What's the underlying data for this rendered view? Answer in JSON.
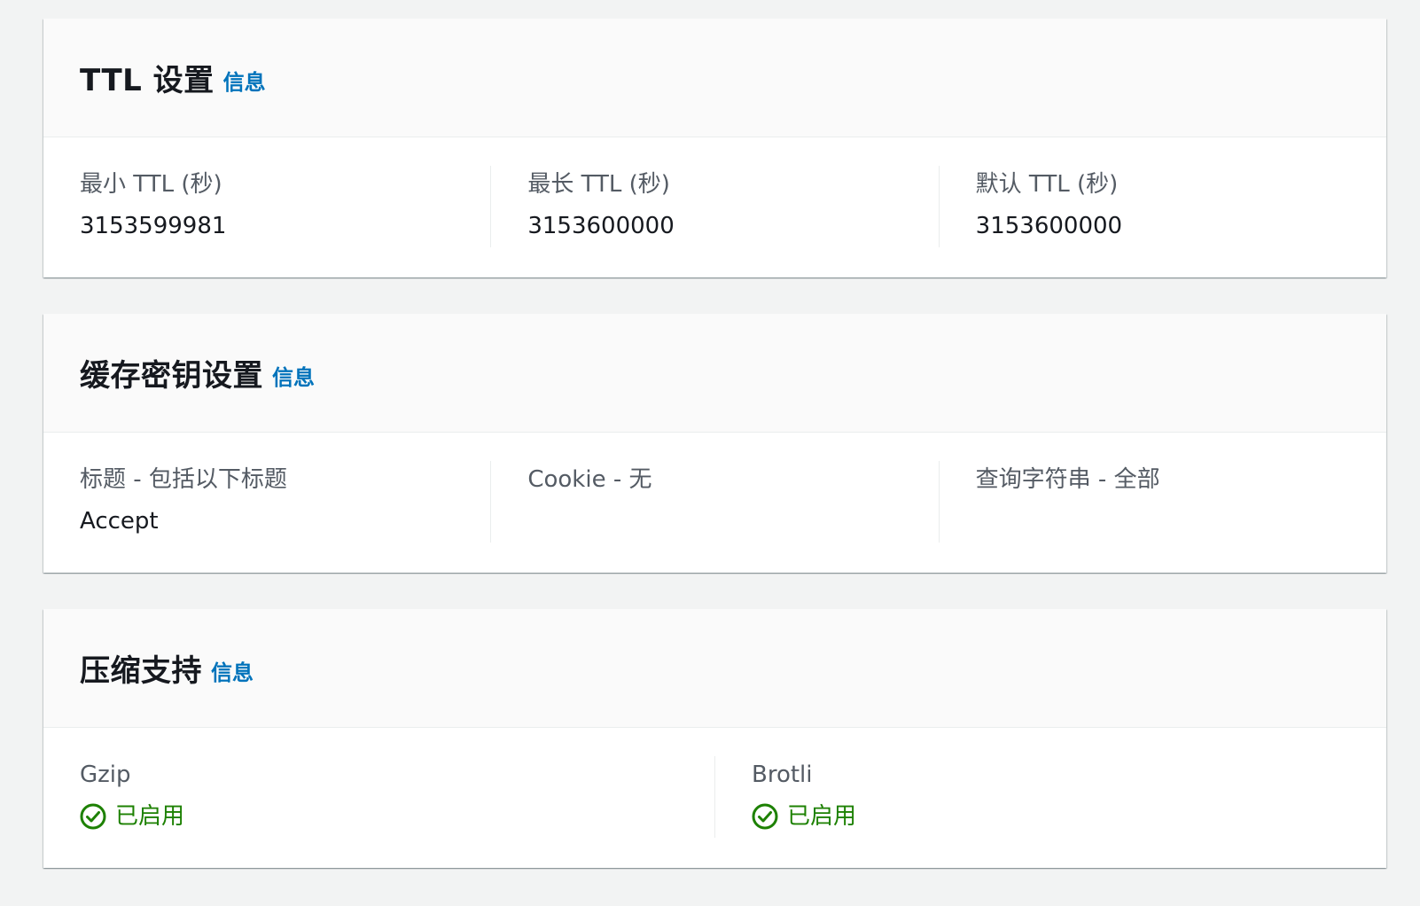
{
  "ttl": {
    "title": "TTL 设置",
    "info": "信息",
    "fields": [
      {
        "label": "最小 TTL (秒)",
        "value": "3153599981"
      },
      {
        "label": "最长 TTL (秒)",
        "value": "3153600000"
      },
      {
        "label": "默认 TTL (秒)",
        "value": "3153600000"
      }
    ]
  },
  "cache_key": {
    "title": "缓存密钥设置",
    "info": "信息",
    "fields": [
      {
        "label": "标题 - 包括以下标题",
        "value": "Accept"
      },
      {
        "label": "Cookie - 无",
        "value": ""
      },
      {
        "label": "查询字符串 - 全部",
        "value": ""
      }
    ]
  },
  "compression": {
    "title": "压缩支持",
    "info": "信息",
    "fields": [
      {
        "label": "Gzip",
        "status": "已启用",
        "icon": "check-circle-icon"
      },
      {
        "label": "Brotli",
        "status": "已启用",
        "icon": "check-circle-icon"
      }
    ]
  },
  "colors": {
    "link": "#0073bb",
    "success": "#1d8102",
    "background": "#f2f3f3"
  }
}
